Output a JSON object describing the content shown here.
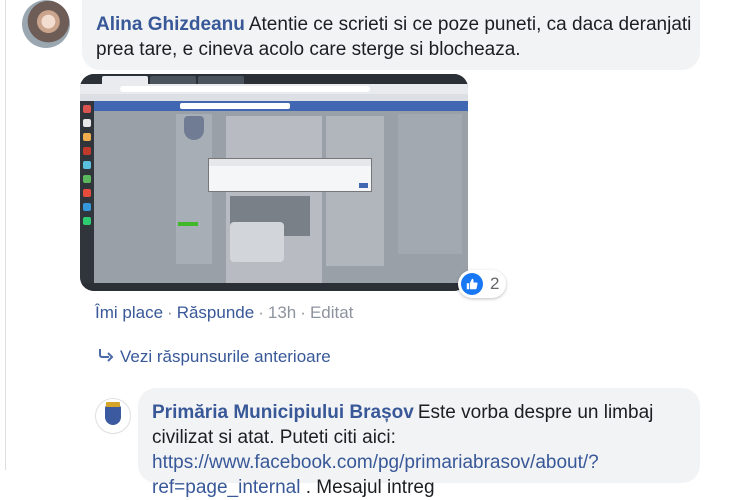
{
  "comment1": {
    "author": "Alina Ghizdeanu",
    "text": "Atentie ce scrieti si ce poze puneti, ca daca deranjati prea tare, e cineva acolo care sterge si blocheaza.",
    "reaction_count": "2",
    "actions": {
      "like": "Îmi place",
      "reply": "Răspunde",
      "time": "13h",
      "edited": "Editat",
      "separator": "·"
    }
  },
  "previous_replies": "Vezi răspunsurile anterioare",
  "comment2": {
    "author": "Primăria Municipiului Brașov",
    "text_before_link": "Este vorba despre un limbaj civilizat si atat. Puteti citi aici:",
    "link": "https://www.facebook.com/pg/primariabrasov/about/?ref=page_internal",
    "text_after_link": ". Mesajul intreg"
  },
  "icons": {
    "like": "thumbs-up-icon",
    "reply_arrow": "reply-arrow-icon",
    "avatar2": "city-crest-icon"
  },
  "colors": {
    "link": "#385898",
    "bubble": "#f2f3f5",
    "like_blue": "#1877f2",
    "meta_gray": "#8d949e"
  }
}
